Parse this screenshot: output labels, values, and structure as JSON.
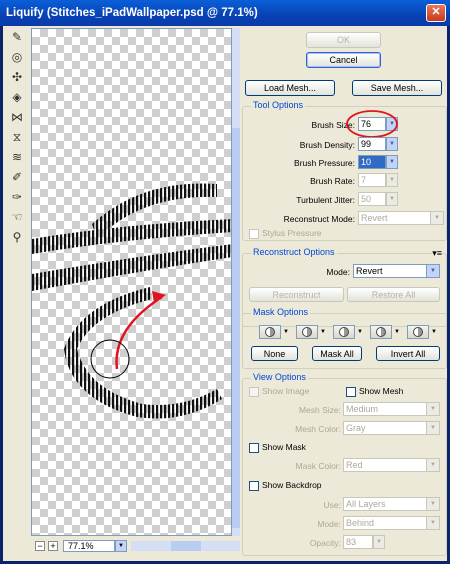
{
  "window": {
    "title": "Liquify (Stitches_iPadWallpaper.psd @ 77.1%)"
  },
  "buttons": {
    "ok": "OK",
    "cancel": "Cancel",
    "load_mesh": "Load Mesh...",
    "save_mesh": "Save Mesh..."
  },
  "tool_options": {
    "title": "Tool Options",
    "brush_size_label": "Brush Size:",
    "brush_size": "76",
    "brush_density_label": "Brush Density:",
    "brush_density": "99",
    "brush_pressure_label": "Brush Pressure:",
    "brush_pressure": "10",
    "brush_rate_label": "Brush Rate:",
    "brush_rate": "7",
    "turbulent_jitter_label": "Turbulent Jitter:",
    "turbulent_jitter": "50",
    "reconstruct_mode_label": "Reconstruct Mode:",
    "reconstruct_mode": "Revert",
    "stylus_pressure": "Stylus Pressure"
  },
  "reconstruct_options": {
    "title": "Reconstruct Options",
    "mode_label": "Mode:",
    "mode": "Revert",
    "reconstruct_btn": "Reconstruct",
    "restore_all_btn": "Restore All"
  },
  "mask_options": {
    "title": "Mask Options",
    "none_btn": "None",
    "mask_all_btn": "Mask All",
    "invert_all_btn": "Invert All"
  },
  "view_options": {
    "title": "View Options",
    "show_image": "Show Image",
    "show_mesh": "Show Mesh",
    "mesh_size_label": "Mesh Size:",
    "mesh_size": "Medium",
    "mesh_color_label": "Mesh Color:",
    "mesh_color": "Gray",
    "show_mask": "Show Mask",
    "mask_color_label": "Mask Color:",
    "mask_color": "Red",
    "show_backdrop": "Show Backdrop",
    "use_label": "Use:",
    "use": "All Layers",
    "mode_label": "Mode:",
    "mode": "Behind",
    "opacity_label": "Opacity:",
    "opacity": "83"
  },
  "zoom": {
    "value": "77.1%"
  },
  "colors": {
    "accent": "#0046d5",
    "annotation": "#e0141e"
  }
}
